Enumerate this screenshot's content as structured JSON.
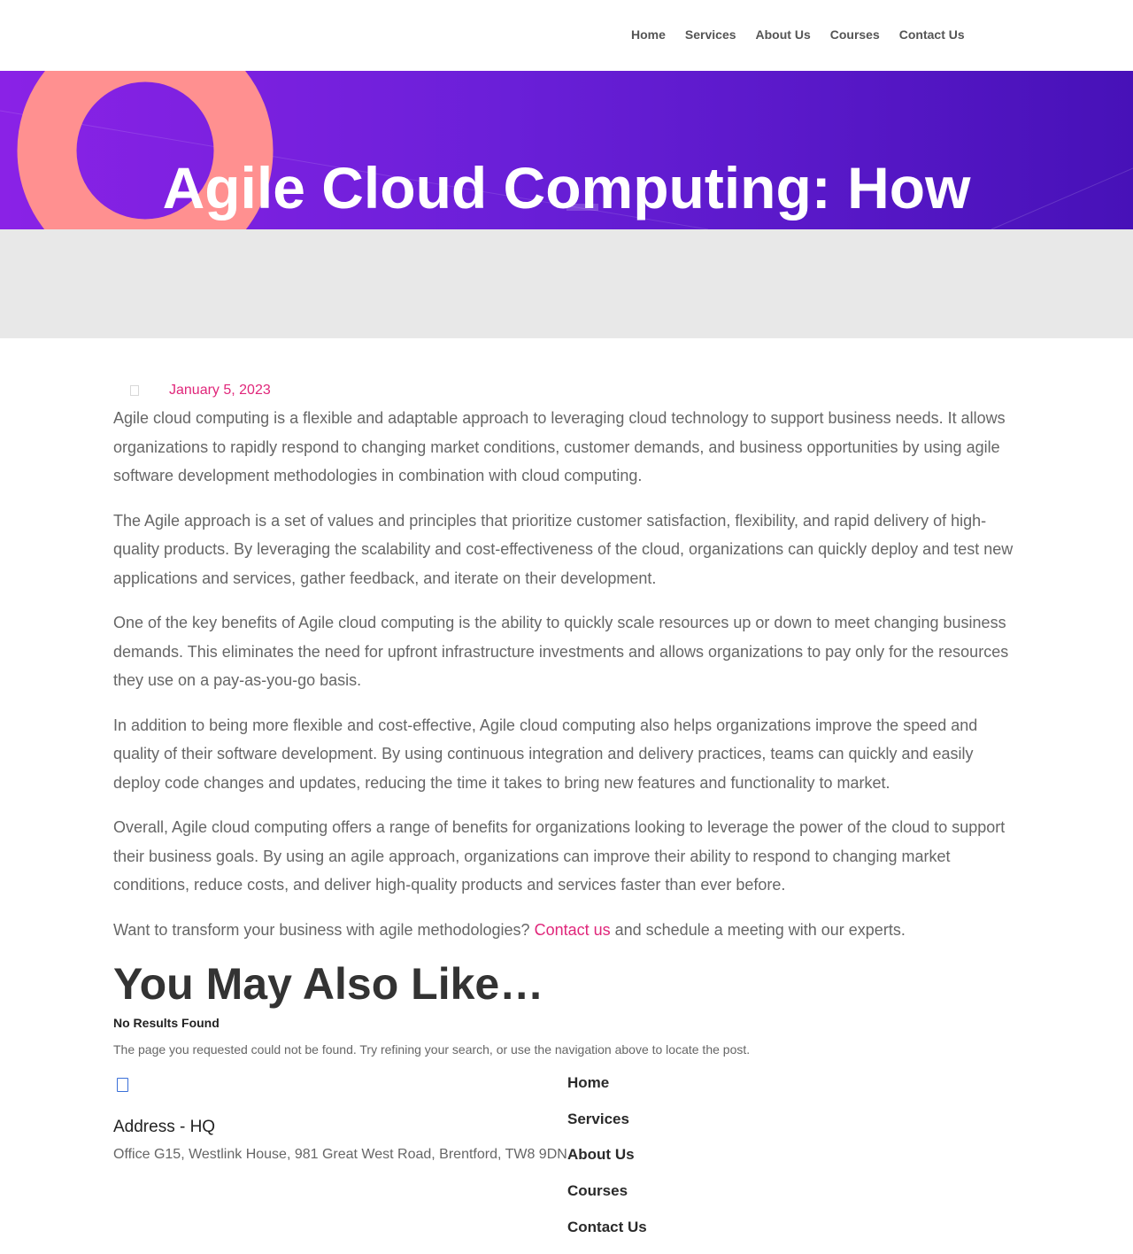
{
  "nav": {
    "items": [
      "Home",
      "Services",
      "About Us",
      "Courses",
      "Contact Us"
    ]
  },
  "hero": {
    "title": "Agile Cloud Computing: How"
  },
  "post": {
    "date": "January 5, 2023",
    "paragraphs": [
      "Agile cloud computing is a flexible and adaptable approach to leveraging cloud technology to support business needs. It allows organizations to rapidly respond to changing market conditions, customer demands, and business opportunities by using agile software development methodologies in combination with cloud computing.",
      "The Agile approach is a set of values and principles that prioritize customer satisfaction, flexibility, and rapid delivery of high-quality products. By leveraging the scalability and cost-effectiveness of the cloud, organizations can quickly deploy and test new applications and services, gather feedback, and iterate on their development.",
      "One of the key benefits of Agile cloud computing is the ability to quickly scale resources up or down to meet changing business demands. This eliminates the need for upfront infrastructure investments and allows organizations to pay only for the resources they use on a pay-as-you-go basis.",
      "In addition to being more flexible and cost-effective, Agile cloud computing also helps organizations improve the speed and quality of their software development. By using continuous integration and delivery practices, teams can quickly and easily deploy code changes and updates, reducing the time it takes to bring new features and functionality to market.",
      "Overall, Agile cloud computing offers a range of benefits for organizations looking to leverage the power of the cloud to support their business goals. By using an agile approach, organizations can improve their ability to respond to changing market conditions, reduce costs, and deliver high-quality products and services faster than ever before."
    ],
    "cta_before": "Want to transform your business with agile methodologies? ",
    "cta_link": "Contact us",
    "cta_after": " and schedule a meeting with our experts."
  },
  "related": {
    "heading": "You May Also Like…",
    "no_results_title": "No Results Found",
    "no_results_text": "The page you requested could not be found. Try refining your search, or use the navigation above to locate the post."
  },
  "footer": {
    "address_title": "Address - HQ",
    "address_text": "Office G15, Westlink House, 981 Great West Road, Brentford, TW8 9DN",
    "nav": [
      "Home",
      "Services",
      "About Us",
      "Courses",
      "Contact Us"
    ]
  },
  "colors": {
    "accent": "#e0267a",
    "hero_start": "#8a22e6",
    "hero_end": "#4711b8",
    "ring": "#ff9090"
  }
}
